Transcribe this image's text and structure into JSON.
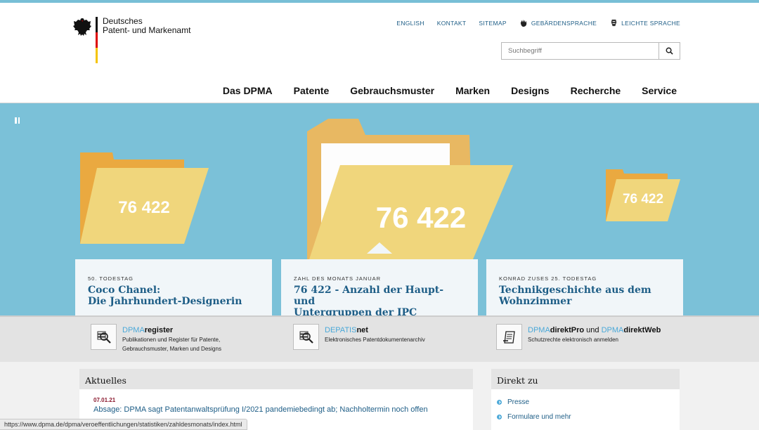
{
  "header": {
    "logo_line1": "Deutsches",
    "logo_line2": "Patent- und Markenamt",
    "topnav": [
      {
        "label": "ENGLISH"
      },
      {
        "label": "KONTAKT"
      },
      {
        "label": "SITEMAP"
      },
      {
        "label": "GEBÄRDENSPRACHE",
        "icon": "sign-language-icon"
      },
      {
        "label": "LEICHTE SPRACHE",
        "icon": "easy-language-icon"
      }
    ],
    "search_placeholder": "Suchbegriff",
    "mainnav": [
      "Das DPMA",
      "Patente",
      "Gebrauchsmuster",
      "Marken",
      "Designs",
      "Recherche",
      "Service"
    ]
  },
  "hero": {
    "folder_numbers": [
      "76 422",
      "76 422",
      "76 422"
    ],
    "cards": [
      {
        "kicker": "50. TODESTAG",
        "title_line1": "Coco Chanel:",
        "title_line2": "Die Jahrhundert-Designerin"
      },
      {
        "kicker": "ZAHL DES MONATS JANUAR",
        "title_line1": "76 422 - Anzahl der Haupt- und",
        "title_line2": "Untergruppen der IPC"
      },
      {
        "kicker": "KONRAD ZUSES 25. TODESTAG",
        "title_line1": "Technikgeschichte aus dem",
        "title_line2": "Wohnzimmer"
      }
    ]
  },
  "services": [
    {
      "brand": "DPMA",
      "name": "register",
      "desc_line1": "Publikationen und Register für Patente,",
      "desc_line2": "Gebrauchsmuster, Marken und Designs"
    },
    {
      "brand": "DEPATIS",
      "name": "net",
      "desc_line1": "Elektronisches Patentdokumentenarchiv",
      "desc_line2": ""
    },
    {
      "brand": "DPMA",
      "name": "direktPro",
      "connector": "und",
      "brand2": "DPMA",
      "name2": "direktWeb",
      "desc_line1": "Schutzrechte elektronisch anmelden",
      "desc_line2": ""
    }
  ],
  "aktuelles": {
    "heading": "Aktuelles",
    "date": "07.01.21",
    "title": "Absage: DPMA sagt Patentanwaltsprüfung I/2021 pandemiebedingt ab; Nachholtermin noch offen"
  },
  "direkt": {
    "heading": "Direkt zu",
    "links": [
      "Presse",
      "Formulare und mehr"
    ]
  },
  "statusbar": "https://www.dpma.de/dpma/veroeffentlichungen/statistiken/zahldesmonats/index.html",
  "colors": {
    "accent_blue": "#1d5d86",
    "hero_bg": "#7bc1d8",
    "folder_yellow": "#f0d67c",
    "folder_orange": "#eaa940"
  }
}
